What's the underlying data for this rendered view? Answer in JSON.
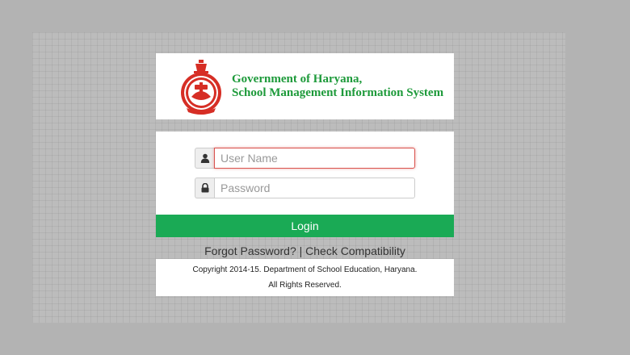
{
  "header": {
    "org_line1": "Government of Haryana,",
    "org_line2": "School Management Information System",
    "emblem_icon": "haryana-emblem-icon"
  },
  "login_form": {
    "username_placeholder": "User Name",
    "username_value": "",
    "username_icon": "user-icon",
    "password_placeholder": "Password",
    "password_value": "",
    "password_icon": "lock-icon",
    "login_label": "Login"
  },
  "links": {
    "forgot_password": "Forgot Password?",
    "separator": "|",
    "check_compatibility": "Check Compatibility"
  },
  "footer": {
    "copyright": "Copyright 2014-15. Department of School Education, Haryana.",
    "rights": "All Rights Reserved."
  },
  "colors": {
    "brand_green": "#1aaa55",
    "title_green": "#1d9a3a",
    "emblem_red": "#d62e25",
    "focus_red": "#d9534f",
    "background": "#b3b3b3"
  }
}
